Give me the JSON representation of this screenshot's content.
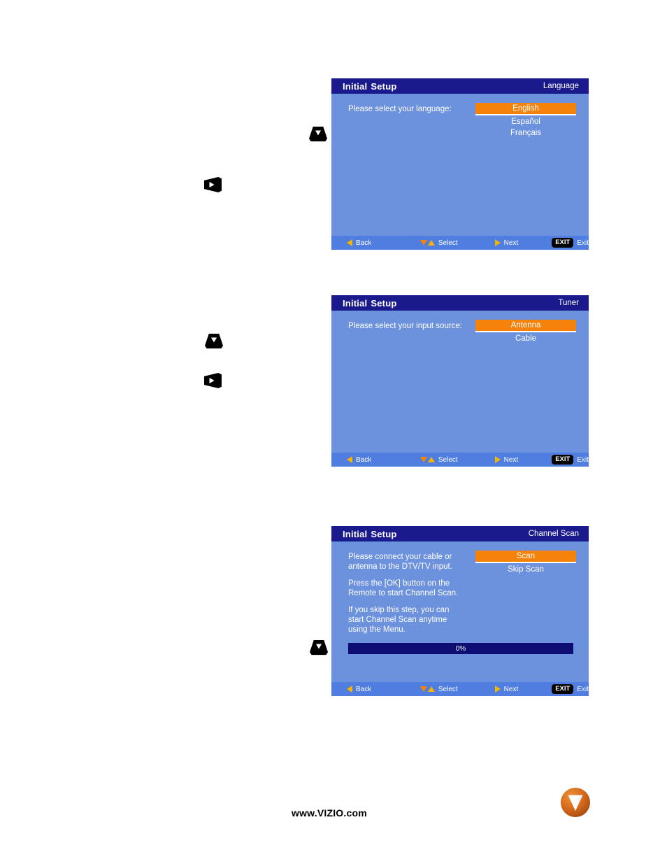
{
  "page": {
    "url_text": "www.VIZIO.com",
    "logo": {
      "name": "vizio-logo",
      "letter": "V",
      "color": "#d4691b"
    }
  },
  "common": {
    "title_word1": "Initial",
    "title_word2": "Setup",
    "footer": {
      "back": "Back",
      "select": "Select",
      "next": "Next",
      "exit_badge": "EXIT",
      "exit": "Exit"
    },
    "colors": {
      "header_bg": "#1a1a8c",
      "body_bg": "#6d92dd",
      "footer_bg": "#4f7ee0",
      "highlight": "#f5820b",
      "progress_bg": "#0d0d73",
      "arrow_yellow": "#f5b400"
    }
  },
  "panels": [
    {
      "id": "language",
      "section": "Language",
      "paragraphs": [
        [
          "Please select your language:"
        ]
      ],
      "options": [
        {
          "label": "English",
          "selected": true
        },
        {
          "label": "Español",
          "selected": false
        },
        {
          "label": "Français",
          "selected": false
        }
      ]
    },
    {
      "id": "tuner",
      "section": "Tuner",
      "paragraphs": [
        [
          "Please select your input source:"
        ]
      ],
      "options": [
        {
          "label": "Antenna",
          "selected": true
        },
        {
          "label": "Cable",
          "selected": false
        }
      ]
    },
    {
      "id": "channel-scan",
      "section": "Channel Scan",
      "paragraphs": [
        [
          "Please connect your cable or",
          "antenna to the DTV/TV input."
        ],
        [
          "Press the [OK] button on the",
          "Remote to start Channel Scan."
        ],
        [
          "If you skip this step, you can",
          "start Channel Scan anytime",
          "using the Menu."
        ]
      ],
      "options": [
        {
          "label": "Scan",
          "selected": true
        },
        {
          "label": "Skip Scan",
          "selected": false
        }
      ],
      "progress": {
        "label": "0%",
        "value": 0
      }
    }
  ],
  "remote_keys": [
    {
      "id": "key-down-1",
      "direction": "down"
    },
    {
      "id": "key-right-1",
      "direction": "right"
    },
    {
      "id": "key-down-2",
      "direction": "down"
    },
    {
      "id": "key-right-2",
      "direction": "right"
    },
    {
      "id": "key-down-3",
      "direction": "down"
    }
  ]
}
